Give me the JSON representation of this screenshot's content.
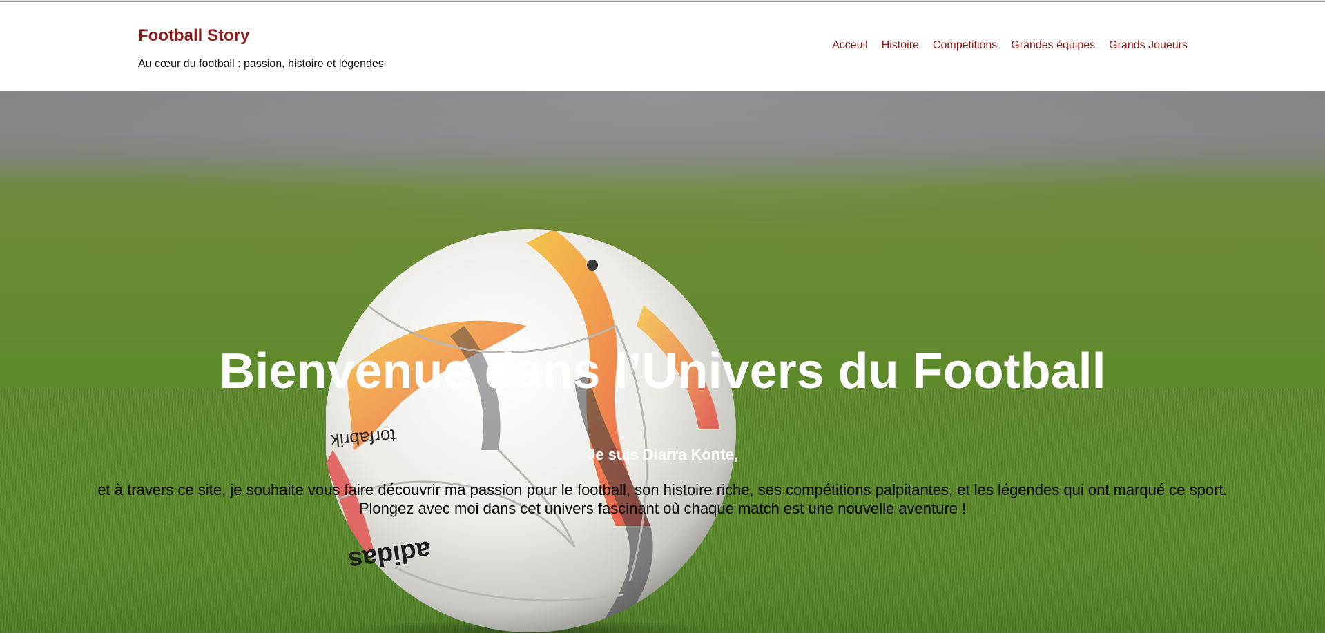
{
  "header": {
    "site_title": "Football Story",
    "tagline": "Au cœur du football : passion, histoire et légendes"
  },
  "nav": {
    "items": [
      {
        "label": "Acceuil"
      },
      {
        "label": "Histoire"
      },
      {
        "label": "Competitions"
      },
      {
        "label": "Grandes équipes"
      },
      {
        "label": "Grands Joueurs"
      }
    ]
  },
  "hero": {
    "heading": "Bienvenue dans l’Univers du Football",
    "intro": "Je suis Diarra Konte,",
    "text": "et à travers ce site, je souhaite vous faire découvrir ma passion pour le football, son histoire riche, ses compétitions palpitantes, et les légendes qui ont marqué ce sport. Plongez avec moi dans cet univers fascinant où chaque match est une nouvelle aventure !",
    "ball_brand": "adidas",
    "ball_model": "torfabrik"
  },
  "colors": {
    "brand": "#8b1a1a",
    "grass": "#5d8b2a",
    "sky": "#858588"
  }
}
